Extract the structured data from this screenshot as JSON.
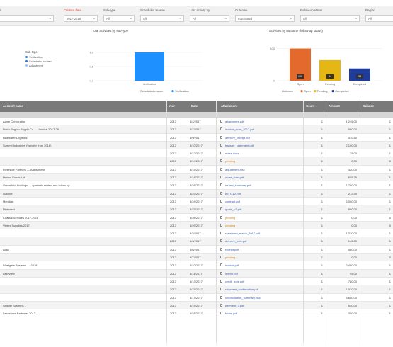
{
  "filters": [
    {
      "label": "Account",
      "value": "All",
      "red": false
    },
    {
      "label": "Created date",
      "value": "2017-2018",
      "red": true
    },
    {
      "label": "Sub-type",
      "value": "All",
      "red": false
    },
    {
      "label": "Scheduled reason",
      "value": "All",
      "red": false
    },
    {
      "label": "Last activity by",
      "value": "All",
      "red": false
    },
    {
      "label": "Outcome",
      "value": "Inactivated",
      "red": false
    },
    {
      "label": "Follow-up status",
      "value": "All",
      "red": false
    },
    {
      "label": "Region",
      "value": "All",
      "red": false
    }
  ],
  "charts": [
    {
      "title": "Total activities by sub-type",
      "legend_title": "Sub-type",
      "legend": [
        {
          "label": "Verification",
          "color": "#1f8ef1"
        },
        {
          "label": "Scheduled review",
          "color": "#2f6fd6"
        },
        {
          "label": "Adjustment",
          "color": "#9fc4f3"
        }
      ],
      "footer_legend_label": "Scheduled reason",
      "footer_legend_item": "Verification",
      "chart_data": {
        "type": "bar",
        "title": "Total activities by sub-type",
        "categories": [
          "Verification"
        ],
        "values": [
          1
        ],
        "ylim": [
          0,
          1.15
        ],
        "yticks": [
          "0.0",
          "0.5",
          "1.0"
        ],
        "colors": [
          "#1e90ff"
        ]
      }
    },
    {
      "title": "Activities by outcome (follow-up status)",
      "footer_legend_label": "Outcome",
      "footer_legend_items": [
        {
          "label": "Open",
          "color": "#e4692c"
        },
        {
          "label": "Pending",
          "color": "#e5b714"
        },
        {
          "label": "Completed",
          "color": "#1f3c9a"
        }
      ],
      "chart_data": {
        "type": "bar",
        "title": "Activities by outcome (follow-up status)",
        "categories": [
          "Open",
          "Pending",
          "Completed"
        ],
        "values": [
          100,
          64,
          38
        ],
        "data_labels": [
          "100",
          "64",
          "38"
        ],
        "ylim": [
          0,
          110
        ],
        "yticks": [
          "0",
          "100"
        ],
        "colors": [
          "#e4692c",
          "#e5b714",
          "#1f3c9a"
        ]
      }
    }
  ],
  "table": {
    "headers": [
      "Account name",
      "Year",
      "Date",
      "Attachment",
      "Count",
      "Amount",
      "Balance"
    ],
    "rows": [
      {
        "name": "Acme Corporation",
        "year": "2017",
        "date": "3/4/2017",
        "attach": "attachment.pdf",
        "orange": false,
        "count": "1",
        "amount": "1,245.00",
        "bal": "1"
      },
      {
        "name": "North Region Supply Co. — Invoice 2017-28",
        "year": "2017",
        "date": "3/7/2017",
        "attach": "invoice_scan_2017.pdf",
        "orange": false,
        "count": "1",
        "amount": "980.00",
        "bal": "1"
      },
      {
        "name": "Bluewater Logistics",
        "year": "2017",
        "date": "3/9/2017",
        "attach": "delivery_receipt.pdf",
        "orange": false,
        "count": "1",
        "amount": "410.50",
        "bal": "1"
      },
      {
        "name": "Summit Industries (transfer from 2016)",
        "year": "2017",
        "date": "3/10/2017",
        "attach": "transfer_statement.pdf",
        "orange": false,
        "count": "1",
        "amount": "2,100.00",
        "bal": "1"
      },
      {
        "name": "",
        "year": "2017",
        "date": "3/12/2017",
        "attach": "notes.docx",
        "orange": false,
        "count": "1",
        "amount": "75.00",
        "bal": "1"
      },
      {
        "name": "",
        "year": "2017",
        "date": "3/14/2017",
        "attach": "pending",
        "orange": true,
        "count": "1",
        "amount": "0.00",
        "bal": "0"
      },
      {
        "name": "Riverside Partners — Adjustment",
        "year": "2017",
        "date": "3/15/2017",
        "attach": "adjustment.xlsx",
        "orange": false,
        "count": "1",
        "amount": "320.00",
        "bal": "1"
      },
      {
        "name": "Harbor Foods Ltd.",
        "year": "2017",
        "date": "3/18/2017",
        "attach": "order_form.pdf",
        "orange": false,
        "count": "1",
        "amount": "655.25",
        "bal": "1"
      },
      {
        "name": "Greenfield Holdings — quarterly review and follow-up",
        "year": "2017",
        "date": "3/21/2017",
        "attach": "review_summary.pdf",
        "orange": false,
        "count": "1",
        "amount": "1,780.00",
        "bal": "1"
      },
      {
        "name": "Oakline",
        "year": "2017",
        "date": "3/23/2017",
        "attach": "po_1182.pdf",
        "orange": false,
        "count": "1",
        "amount": "212.40",
        "bal": "1"
      },
      {
        "name": "Meridian",
        "year": "2017",
        "date": "3/24/2017",
        "attach": "contract.pdf",
        "orange": false,
        "count": "1",
        "amount": "5,000.00",
        "bal": "1"
      },
      {
        "name": "Pinecrest",
        "year": "2017",
        "date": "3/27/2017",
        "attach": "quote_v2.pdf",
        "orange": false,
        "count": "1",
        "amount": "890.00",
        "bal": "1"
      },
      {
        "name": "Coastal Services 2017-2018",
        "year": "2017",
        "date": "3/28/2017",
        "attach": "pending",
        "orange": true,
        "count": "1",
        "amount": "0.00",
        "bal": "0"
      },
      {
        "name": "Vertex Supplies 2017",
        "year": "2017",
        "date": "3/29/2017",
        "attach": "pending",
        "orange": true,
        "count": "1",
        "amount": "0.00",
        "bal": "0"
      },
      {
        "name": "",
        "year": "2017",
        "date": "4/2/2017",
        "attach": "statement_march_2017.pdf",
        "orange": false,
        "count": "1",
        "amount": "1,310.00",
        "bal": "1"
      },
      {
        "name": "",
        "year": "2017",
        "date": "4/4/2017",
        "attach": "delivery_note.pdf",
        "orange": false,
        "count": "1",
        "amount": "145.00",
        "bal": "1"
      },
      {
        "name": "Atlas",
        "year": "2017",
        "date": "4/6/2017",
        "attach": "receipt.pdf",
        "orange": false,
        "count": "1",
        "amount": "460.00",
        "bal": "1"
      },
      {
        "name": "",
        "year": "2017",
        "date": "4/7/2017",
        "attach": "pending",
        "orange": true,
        "count": "1",
        "amount": "0.00",
        "bal": "0"
      },
      {
        "name": "Westgate Systems — 2018",
        "year": "2017",
        "date": "4/10/2017",
        "attach": "invoice.pdf",
        "orange": false,
        "count": "1",
        "amount": "2,450.00",
        "bal": "1"
      },
      {
        "name": "Lakeview",
        "year": "2017",
        "date": "4/11/2017",
        "attach": "memo.pdf",
        "orange": false,
        "count": "1",
        "amount": "95.00",
        "bal": "1"
      },
      {
        "name": "",
        "year": "2017",
        "date": "4/13/2017",
        "attach": "credit_note.pdf",
        "orange": false,
        "count": "1",
        "amount": "780.00",
        "bal": "1"
      },
      {
        "name": "",
        "year": "2017",
        "date": "4/15/2017",
        "attach": "shipment_confirmation.pdf",
        "orange": false,
        "count": "1",
        "amount": "1,020.00",
        "bal": "1"
      },
      {
        "name": "",
        "year": "2017",
        "date": "4/17/2017",
        "attach": "reconciliation_summary.xlsx",
        "orange": false,
        "count": "1",
        "amount": "3,600.00",
        "bal": "1"
      },
      {
        "name": "Granite Systems 1",
        "year": "2017",
        "date": "4/19/2017",
        "attach": "payment_3.pdf",
        "orange": false,
        "count": "1",
        "amount": "540.00",
        "bal": "1"
      },
      {
        "name": "Lakeshore Partners, 2017",
        "year": "2017",
        "date": "4/21/2017",
        "attach": "terms.pdf",
        "orange": false,
        "count": "1",
        "amount": "300.00",
        "bal": "1"
      }
    ]
  }
}
